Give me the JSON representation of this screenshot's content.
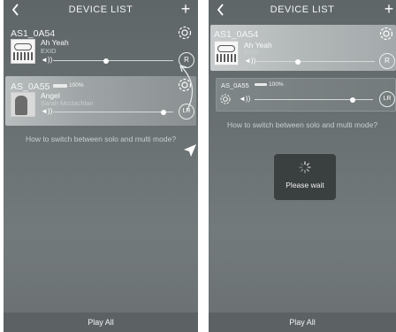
{
  "left": {
    "topbar": {
      "title": "DEVICE LIST"
    },
    "devices": [
      {
        "name": "AS1_0A54",
        "song": "Ah Yeah",
        "artist": "EXID",
        "volume": 0.45,
        "mode": "R"
      },
      {
        "name": "AS_0A55",
        "battery": "100%",
        "song": "Angel",
        "artist": "Sarah Mcclachlan",
        "volume": 0.92,
        "mode": "LR"
      }
    ],
    "hint": "How to switch between solo and multi mode?",
    "footer": {
      "play_all": "Play All"
    }
  },
  "right": {
    "topbar": {
      "title": "DEVICE LIST"
    },
    "devices": [
      {
        "name": "AS1_0A54",
        "song": "Ah Yeah",
        "artist": "EXID",
        "volume": 0.35,
        "mode": "R"
      },
      {
        "name": "AS_0A55",
        "battery": "100%",
        "volume": 0.82,
        "mode": "LR"
      }
    ],
    "hint": "How to switch between solo and multi mode?",
    "wait_text": "Please wait",
    "footer": {
      "play_all": "Play All"
    }
  },
  "icons": {
    "back": "chevron-left-icon",
    "add": "plus-icon",
    "settings": "gear-icon",
    "volume": "speaker-icon"
  }
}
